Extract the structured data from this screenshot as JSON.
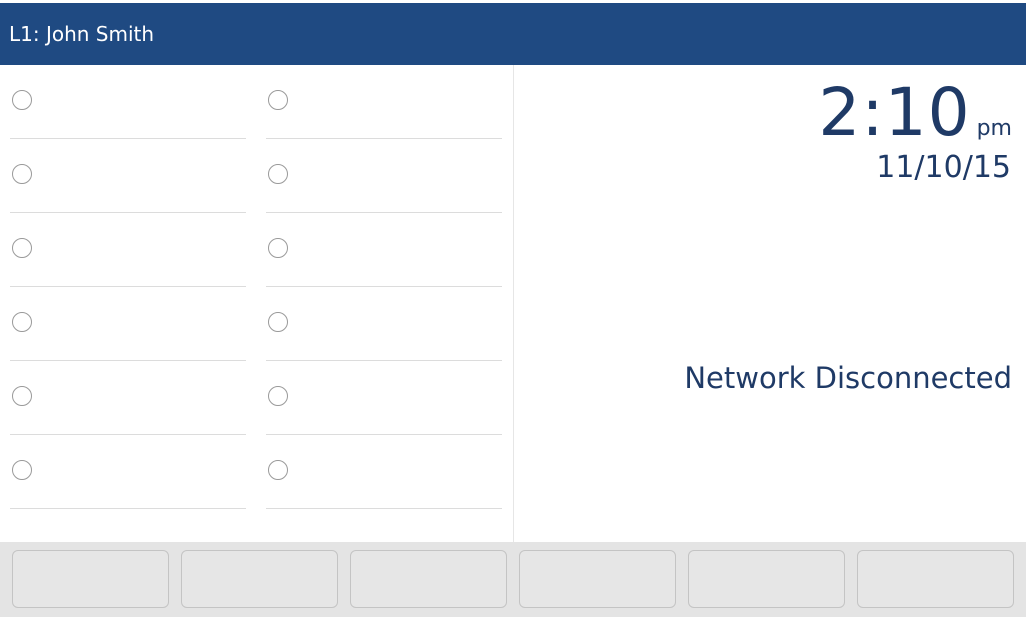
{
  "header": {
    "line_label": "L1: John Smith"
  },
  "programmable_keys": {
    "left_column": [
      {
        "label": ""
      },
      {
        "label": ""
      },
      {
        "label": ""
      },
      {
        "label": ""
      },
      {
        "label": ""
      },
      {
        "label": ""
      }
    ],
    "right_column": [
      {
        "label": ""
      },
      {
        "label": ""
      },
      {
        "label": ""
      },
      {
        "label": ""
      },
      {
        "label": ""
      },
      {
        "label": ""
      }
    ]
  },
  "idle_screen": {
    "time": "2:10",
    "ampm": "pm",
    "date": "11/10/15",
    "network_status": "Network Disconnected"
  },
  "softkeys": [
    {
      "label": ""
    },
    {
      "label": ""
    },
    {
      "label": ""
    },
    {
      "label": ""
    },
    {
      "label": ""
    },
    {
      "label": ""
    }
  ],
  "colors": {
    "header_background": "#1f4a82",
    "text_primary": "#1f3a66",
    "softkey_background": "#e6e6e6"
  }
}
